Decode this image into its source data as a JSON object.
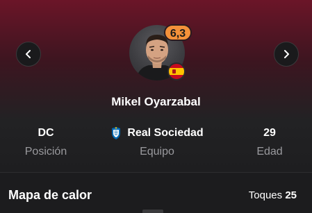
{
  "header": {
    "prev_icon": "chevron-left-icon",
    "next_icon": "chevron-right-icon"
  },
  "player": {
    "name": "Mikel Oyarzabal",
    "rating": "6,3",
    "rating_color": "#f4913a",
    "nationality_flag": "spain-flag-icon"
  },
  "stats": {
    "position_value": "DC",
    "position_label": "Posición",
    "team_value": "Real Sociedad",
    "team_label": "Equipo",
    "team_crest": "real-sociedad-crest-icon",
    "age_value": "29",
    "age_label": "Edad"
  },
  "heatmap": {
    "title": "Mapa de calor",
    "touches_label": "Toques",
    "touches_value": "25"
  },
  "colors": {
    "header_top": "#6b1528",
    "background": "#1c1c1e",
    "muted_text": "#9a9a9e"
  }
}
